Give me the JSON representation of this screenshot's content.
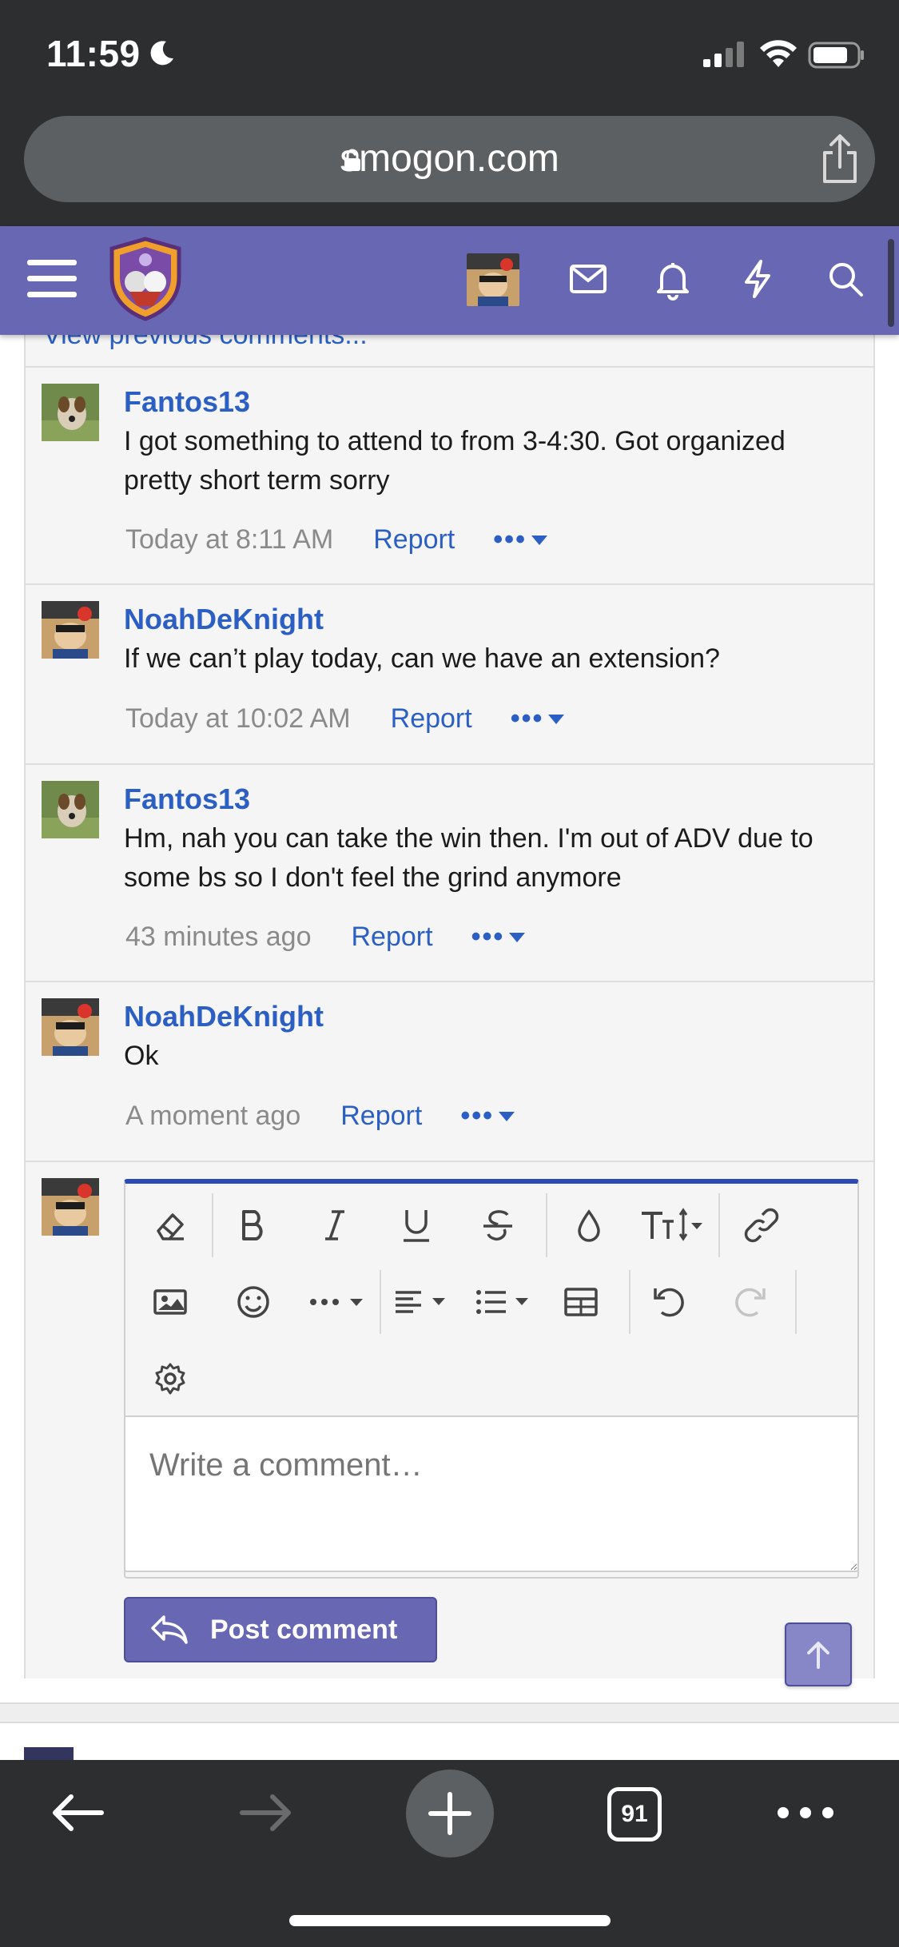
{
  "status_bar": {
    "time": "11:59"
  },
  "browser": {
    "url": "smogon.com",
    "tab_count": "91"
  },
  "thread": {
    "previous_link": "View previous comments..."
  },
  "comments": [
    {
      "author": "Fantos13",
      "text": "I got something to attend to from 3-4:30. Got organized pretty short term sorry",
      "time": "Today at 8:11 AM",
      "report": "Report",
      "more": "•••"
    },
    {
      "author": "NoahDeKnight",
      "text": "If we can’t play today, can we have an extension?",
      "time": "Today at 10:02 AM",
      "report": "Report",
      "more": "•••"
    },
    {
      "author": "Fantos13",
      "text": "Hm, nah you can take the win then. I'm out of ADV due to some bs so I don't feel the grind anymore",
      "time": "43 minutes ago",
      "report": "Report",
      "more": "•••"
    },
    {
      "author": "NoahDeKnight",
      "text": "Ok",
      "time": "A moment ago",
      "report": "Report",
      "more": "•••"
    }
  ],
  "editor": {
    "placeholder": "Write a comment…",
    "post_label": "Post comment",
    "toolbar_icons": [
      "eraser-icon",
      "bold-icon",
      "italic-icon",
      "underline-icon",
      "strikethrough-icon",
      "text-color-icon",
      "font-size-icon",
      "link-icon",
      "image-icon",
      "emoji-icon",
      "more-options-icon",
      "align-icon",
      "list-icon",
      "table-icon",
      "undo-icon",
      "redo-icon",
      "settings-icon"
    ]
  },
  "colors": {
    "brand": "#6867b3",
    "link": "#2b5fc4",
    "editor_accent": "#2b4ab3",
    "chrome": "#2d2e30"
  }
}
